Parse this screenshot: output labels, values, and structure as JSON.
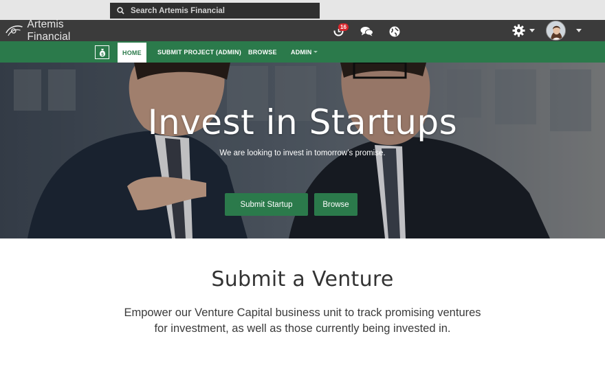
{
  "app": {
    "brand_name": "Artemis Financial",
    "search_placeholder": "Search Artemis Financial",
    "notification_count": "16"
  },
  "icons": {
    "logo": "artemis-logo",
    "search": "search-icon",
    "notifications": "refresh-bell-icon",
    "messages": "chat-bubbles-icon",
    "globe": "globe-icon",
    "settings": "gear-icon",
    "nav_logo": "money-bag-icon"
  },
  "nav": {
    "items": [
      {
        "label": "HOME"
      },
      {
        "label": "SUBMIT PROJECT (ADMIN)"
      },
      {
        "label": "BROWSE"
      },
      {
        "label": "ADMIN"
      }
    ]
  },
  "hero": {
    "title": "Invest in Startups",
    "subtitle": "We are looking to invest in tomorrow’s promise.",
    "primary_button": "Submit Startup",
    "secondary_button": "Browse"
  },
  "section": {
    "title": "Submit a Venture",
    "text": "Empower our Venture Capital business unit to track promising ventures for investment, as well as those currently being invested in."
  },
  "colors": {
    "topbar": "#3b3b3b",
    "accent_green": "#2b7a4b",
    "badge_red": "#d9262c"
  }
}
